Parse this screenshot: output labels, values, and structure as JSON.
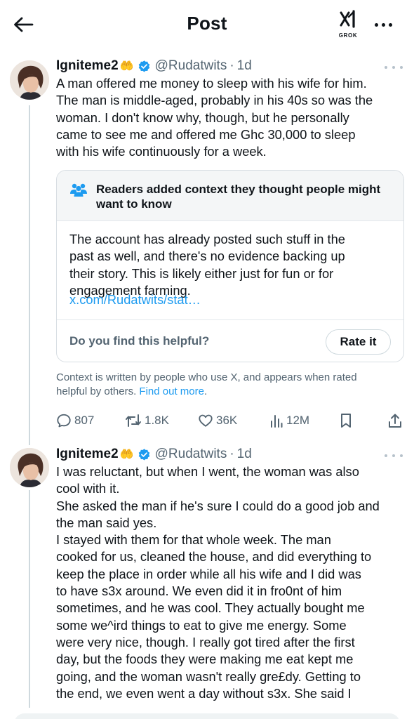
{
  "header": {
    "title": "Post",
    "grok_label": "GROK"
  },
  "tweets": [
    {
      "display_name": "Igniteme2",
      "emoji": "🤲",
      "handle": "@Rudatwits",
      "separator": "·",
      "time": "1d",
      "lines": [
        "A man offered me money to sleep with his wife for him.",
        "The man is middle-aged, probably in his 40s so was the",
        "woman. I don't know why, though, but he personally",
        "came to see me and offered me Ghc 30,000 to sleep",
        "with his wife continuously for a week."
      ]
    },
    {
      "display_name": "Igniteme2",
      "emoji": "🤲",
      "handle": "@Rudatwits",
      "separator": "·",
      "time": "1d",
      "lines": [
        "I was reluctant, but when I went, the woman was also",
        "cool with it.",
        "She asked the man if he's sure I could do a good job and",
        "the man said yes.",
        "I stayed with them for that whole week. The man",
        "cooked for us, cleaned the house, and did everything to",
        "keep the place in order while all his wife and I did was",
        "to have s3x around. We even did it in fro0nt of him",
        "sometimes, and he was cool. They actually bought me",
        "some we^ird things to eat to give me energy. Some",
        "were very nice, though. I really got tired after the first",
        "day, but the foods they were making me eat kept me",
        "going, and the woman wasn't really gre£dy. Getting to",
        "the end, we even went a day without s3x. She said I"
      ]
    }
  ],
  "community_note": {
    "title_lines": [
      "Readers added context they thought people might",
      "want to know"
    ],
    "body_lines": [
      "The account has already posted such stuff in the",
      "past as well, and there's no evidence backing up",
      "their story. This is likely either just for fun or for",
      "engagement farming."
    ],
    "link": "x.com/Rudatwits/stat…",
    "question": "Do you find this helpful?",
    "rate_label": "Rate it"
  },
  "context": {
    "line1": "Context is written by people who use X, and appears when rated",
    "line2": "helpful by others.",
    "find_out": "Find out more",
    "period": "."
  },
  "actions": {
    "replies": "807",
    "reposts": "1.8K",
    "likes": "36K",
    "views": "12M"
  },
  "colors": {
    "text": "#0f1419",
    "secondary": "#536471",
    "link": "#1d9bf0",
    "verified": "#1d9bf0",
    "emoji": "#f5b82e"
  },
  "icons": [
    "back-arrow-icon",
    "grok-icon",
    "more-icon",
    "verified-badge-icon",
    "people-icon",
    "reply-icon",
    "repost-icon",
    "like-icon",
    "views-icon",
    "bookmark-icon",
    "share-icon"
  ]
}
